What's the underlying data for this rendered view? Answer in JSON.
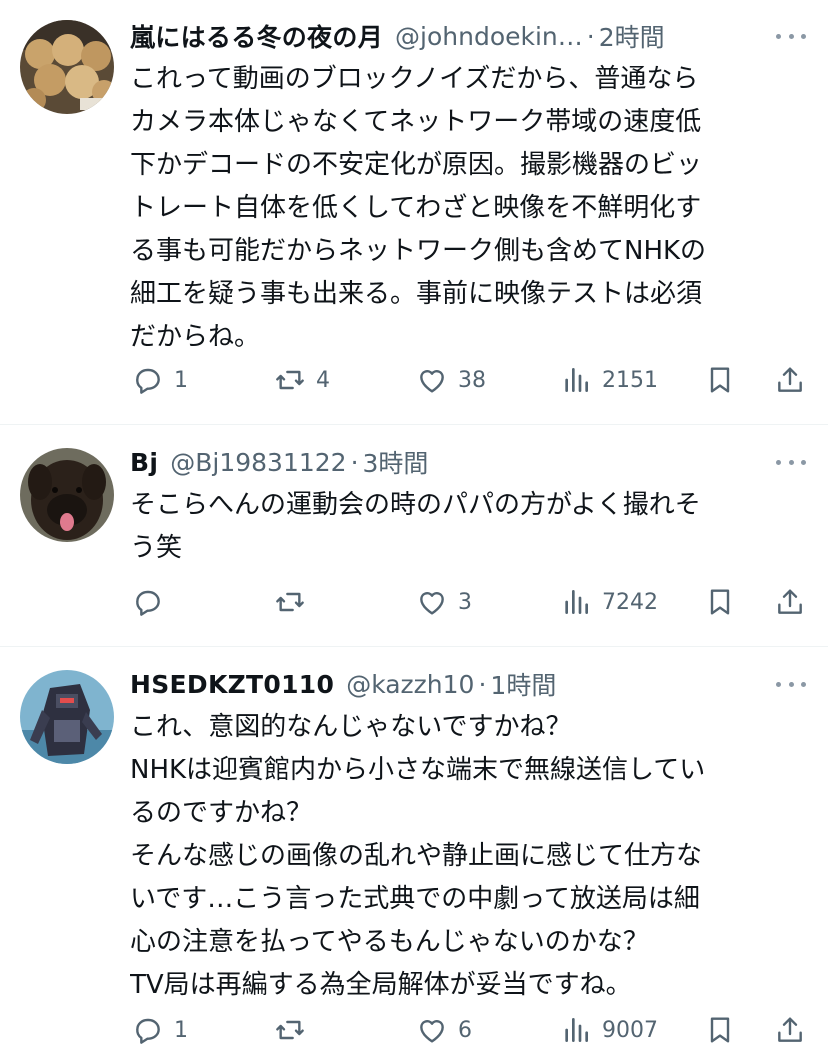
{
  "tweets": [
    {
      "name": "嵐にはるる冬の夜の月",
      "handle": "@johndoekin…",
      "time": "2時間",
      "lines": [
        "これって動画のブロックノイズだから、普通なら",
        "カメラ本体じゃなくてネットワーク帯域の速度低",
        "下かデコードの不安定化が原因。撮影機器のビッ",
        "トレート自体を低くしてわざと映像を不鮮明化す",
        "る事も可能だからネットワーク側も含めてNHKの",
        "細工を疑う事も出来る。事前に映像テストは必須",
        "だからね。"
      ],
      "replies": "1",
      "reposts": "4",
      "likes": "38",
      "views": "2151"
    },
    {
      "name": "Bj",
      "handle": "@Bj19831122",
      "time": "3時間",
      "lines": [
        "そこらへんの運動会の時のパパの方がよく撮れそ",
        "う笑"
      ],
      "replies": "",
      "reposts": "",
      "likes": "3",
      "views": "7242"
    },
    {
      "name": "HSEDKZT0110",
      "handle": "@kazzh10",
      "time": "1時間",
      "lines": [
        "これ、意図的なんじゃないですかね？",
        "NHKは迎賓館内から小さな端末で無線送信してい",
        "るのですかね？",
        "そんな感じの画像の乱れや静止画に感じて仕方な",
        "いです…こう言った式典での中劇って放送局は細",
        "心の注意を払ってやるもんじゃないのかな？",
        "TV局は再編する為全局解体が妥当ですね。"
      ],
      "replies": "1",
      "reposts": "",
      "likes": "6",
      "views": "9007"
    }
  ],
  "separator": "·",
  "icons": {
    "reply": "reply-icon",
    "repost": "repost-icon",
    "like": "like-icon",
    "views": "views-icon",
    "bookmark": "bookmark-icon",
    "share": "share-icon",
    "more": "more-icon"
  },
  "colors": {
    "text": "#0f1419",
    "secondary": "#536471",
    "divider": "#eff3f4"
  }
}
